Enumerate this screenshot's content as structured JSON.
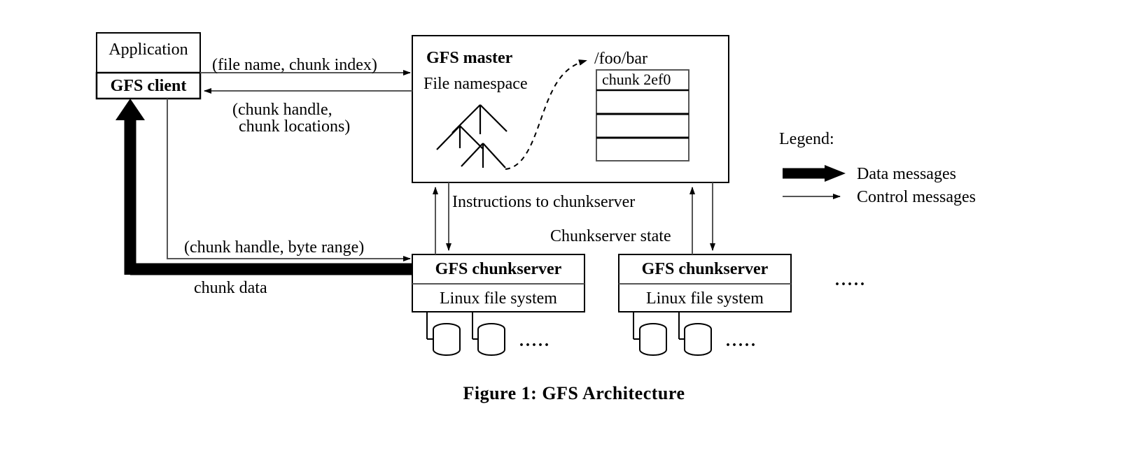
{
  "figure": {
    "caption": "Figure 1:  GFS  Architecture"
  },
  "client_stack": {
    "application_label": "Application",
    "gfs_client_label": "GFS client"
  },
  "master": {
    "title": "GFS master",
    "namespace_label": "File namespace",
    "file_path_label": "/foo/bar",
    "chunk_table": {
      "rows": [
        "chunk 2ef0",
        "",
        "",
        ""
      ]
    }
  },
  "chunkservers": [
    {
      "title": "GFS chunkserver",
      "filesystem_label": "Linux file system",
      "disk_count": 2,
      "more_indicator": "....."
    },
    {
      "title": "GFS chunkserver",
      "filesystem_label": "Linux file system",
      "disk_count": 2,
      "more_indicator": "....."
    }
  ],
  "more_chunkservers_indicator": ".....",
  "messages": {
    "client_to_master": "(file name, chunk index)",
    "master_to_client_line1": "(chunk handle,",
    "master_to_client_line2": "chunk locations)",
    "master_to_chunkserver": "Instructions to chunkserver",
    "chunkserver_to_master": "Chunkserver state",
    "client_to_chunkserver": "(chunk handle, byte range)",
    "chunkserver_to_client": "chunk data"
  },
  "legend": {
    "title": "Legend:",
    "entries": [
      {
        "label": "Data messages",
        "style": "thick-arrow"
      },
      {
        "label": "Control messages",
        "style": "thin-arrow"
      }
    ]
  },
  "colors": {
    "stroke": "#000000",
    "background": "#ffffff",
    "thin_line": "#4a4a4a"
  }
}
